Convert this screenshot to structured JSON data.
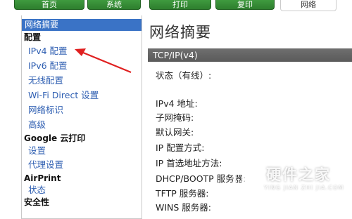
{
  "tabs": [
    {
      "label": "首页",
      "active": false
    },
    {
      "label": "系统",
      "active": false
    },
    {
      "label": "打印",
      "active": false
    },
    {
      "label": "复印",
      "active": false
    },
    {
      "label": "网络",
      "active": true
    }
  ],
  "sidebar": {
    "selected": "网络摘要",
    "groups": [
      {
        "title": "配置",
        "items": [
          "IPv4 配置",
          "IPv6 配置",
          "无线配置",
          "Wi-Fi Direct 设置",
          "网络标识",
          "高级"
        ]
      },
      {
        "title": "Google 云打印",
        "items": [
          "设置",
          "代理设置"
        ]
      },
      {
        "title": "AirPrint",
        "items": [
          "状态"
        ]
      },
      {
        "title": "安全性",
        "items": []
      }
    ]
  },
  "main": {
    "title": "网络摘要",
    "section": "TCP/IP(v4)",
    "status_label": "状态（有线）:",
    "fields": [
      "IPv4 地址:",
      "子网掩码:",
      "默认网关:",
      "IP 配置方式:",
      "IP 首选地址方法:",
      "DHCP/BOOTP 服务器:",
      "TFTP 服务器:",
      "WINS 服务器:"
    ]
  },
  "annotation": {
    "color": "#e02020"
  },
  "watermark": {
    "title": "硬件之家",
    "subtitle": "YING JIAN ZHI JIA.COM"
  },
  "colors": {
    "tab_green": "#2e7f2e",
    "selected_blue": "#3a73c6",
    "link_blue": "#2f5fb2",
    "section_gray": "#626262"
  }
}
